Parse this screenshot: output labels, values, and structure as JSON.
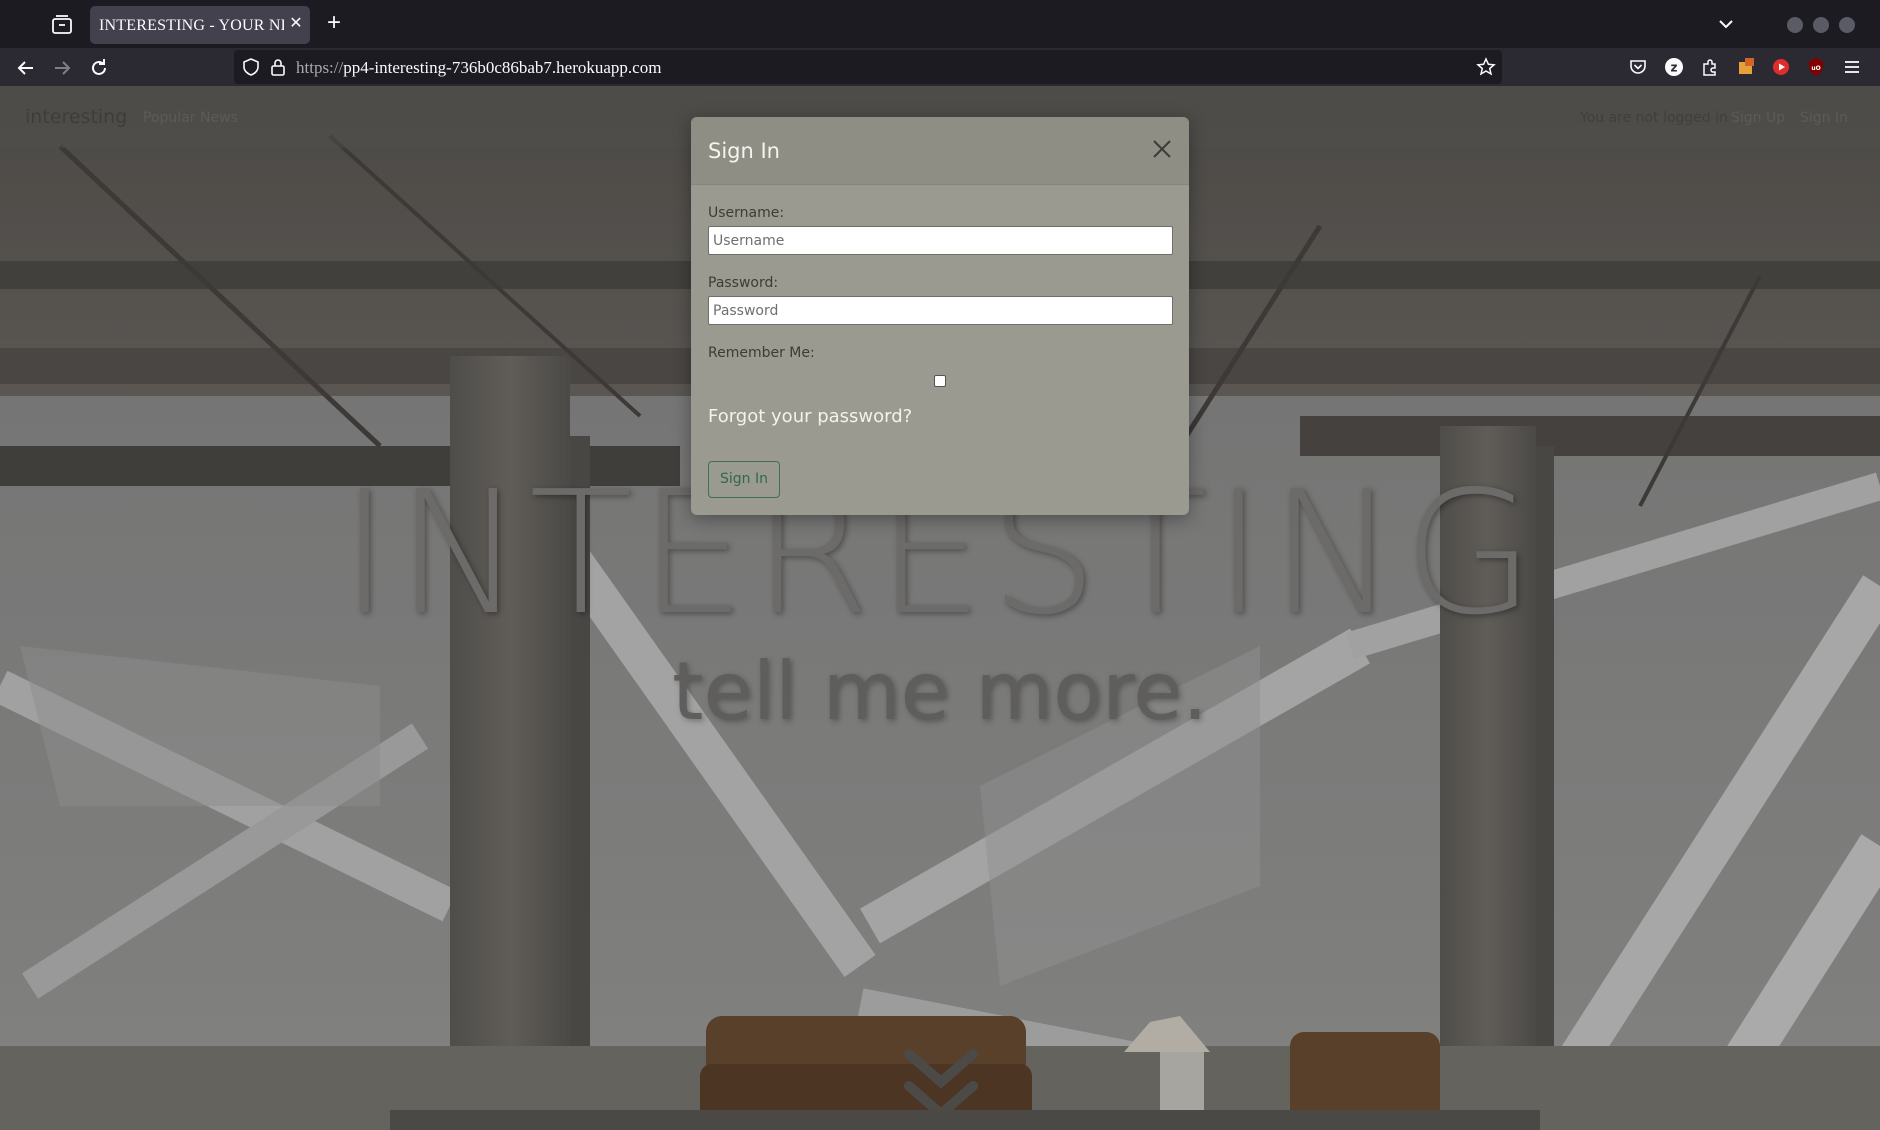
{
  "browser": {
    "tab_title": "INTERESTING - YOUR NEWS",
    "url_scheme": "https://",
    "url_host": "pp4-interesting-736b0c86bab7.herokuapp.com"
  },
  "site": {
    "brand": "interesting",
    "nav_popular": "Popular News",
    "status": "You are not logged in",
    "sign_up": "Sign Up",
    "sign_in": "Sign In"
  },
  "hero": {
    "title": "INTERESTING",
    "subtitle": "tell me more."
  },
  "modal": {
    "title": "Sign In",
    "username_label": "Username:",
    "username_placeholder": "Username",
    "password_label": "Password:",
    "password_placeholder": "Password",
    "remember_label": "Remember Me:",
    "forgot_link": "Forgot your password?",
    "submit_label": "Sign In"
  },
  "colors": {
    "modal_bg": "#9a9a90",
    "button_accent": "#2f6a4c",
    "chrome_bg": "#1c1b22"
  }
}
